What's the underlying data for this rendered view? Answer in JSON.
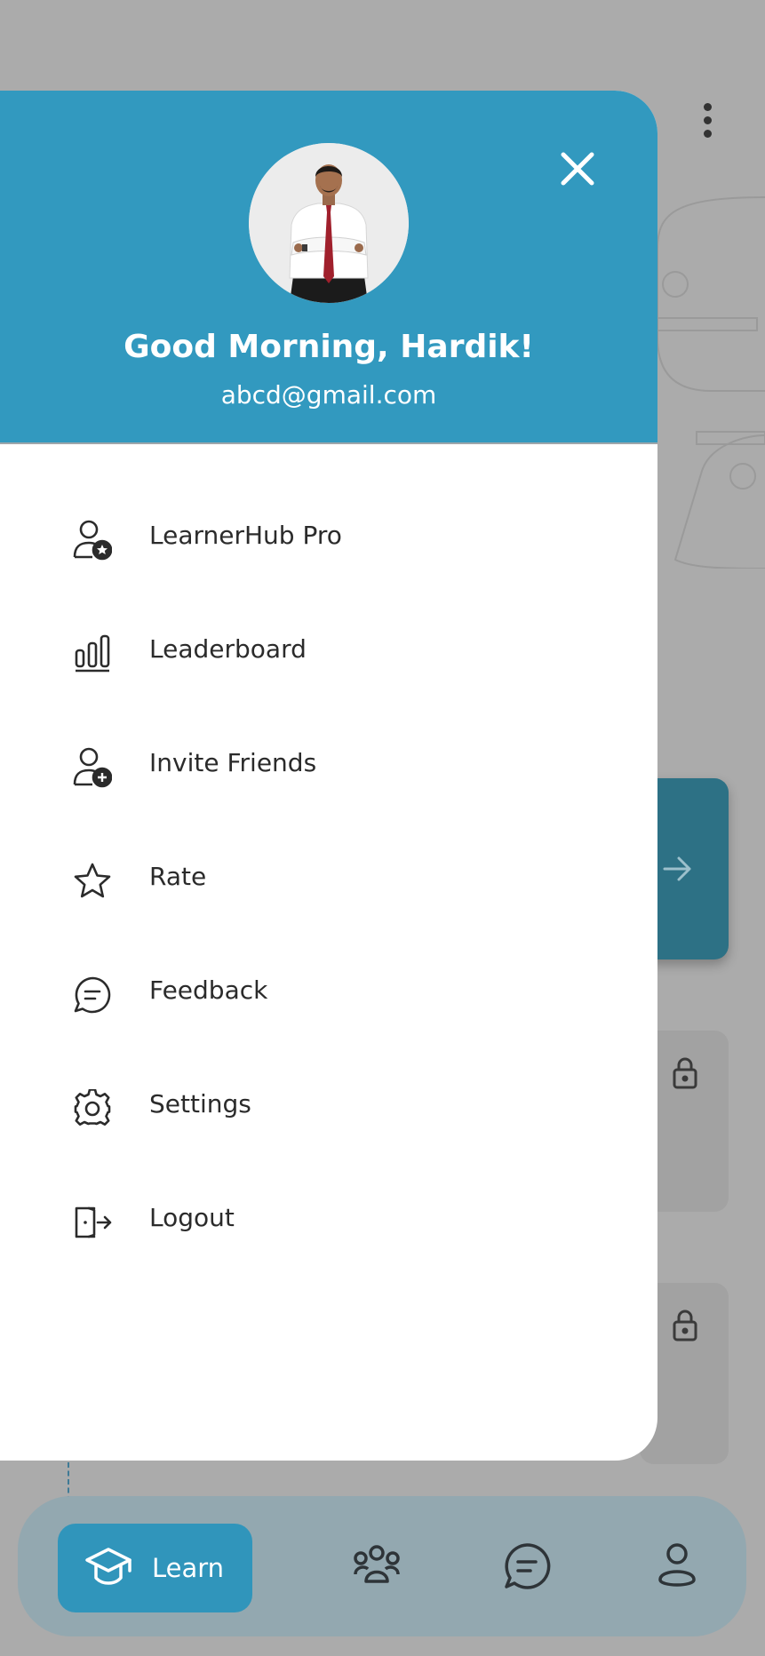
{
  "drawer": {
    "greeting": "Good Morning, Hardik!",
    "email": "abcd@gmail.com",
    "menu": [
      {
        "label": "LearnerHub Pro",
        "icon": "user-star-icon"
      },
      {
        "label": "Leaderboard",
        "icon": "leaderboard-icon"
      },
      {
        "label": "Invite Friends",
        "icon": "user-add-icon"
      },
      {
        "label": "Rate",
        "icon": "star-icon"
      },
      {
        "label": "Feedback",
        "icon": "chat-icon"
      },
      {
        "label": "Settings",
        "icon": "gear-icon"
      },
      {
        "label": "Logout",
        "icon": "logout-icon"
      }
    ]
  },
  "bottom_nav": {
    "active_label": "Learn",
    "items": [
      "learn-icon",
      "community-icon",
      "chat-icon",
      "profile-icon"
    ]
  },
  "colors": {
    "header": "#3299bf",
    "overlay": "#ababab",
    "active_tab": "#3095bb",
    "nav_bar": "#93a8b0"
  }
}
